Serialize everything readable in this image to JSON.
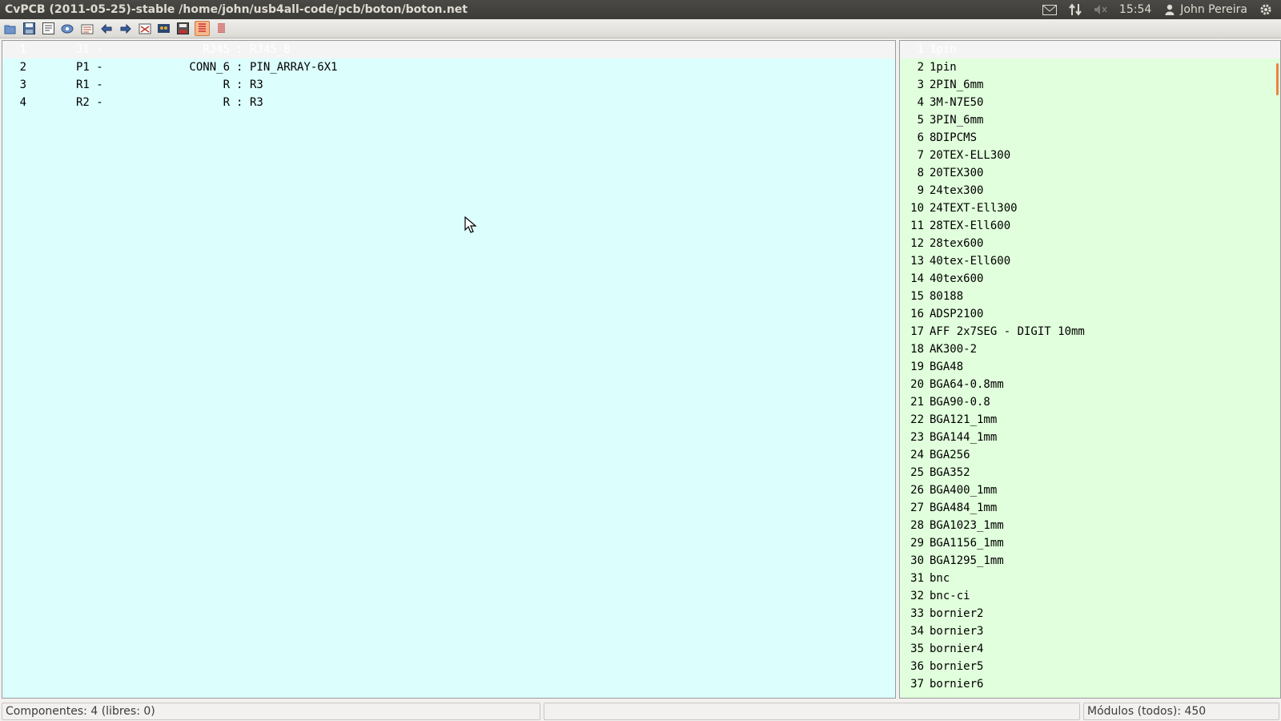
{
  "window": {
    "title": "CvPCB (2011-05-25)-stable /home/john/usb4all-code/pcb/boton/boton.net"
  },
  "panel": {
    "time": "15:54",
    "user": "John Pereira",
    "icons": [
      "mail-icon",
      "network-icon",
      "volume-muted-icon",
      "user-icon",
      "gear-icon"
    ]
  },
  "toolbar": {
    "buttons": [
      "open-icon",
      "save-icon",
      "config-icon",
      "library-icon",
      "auto-associate-icon",
      "previous-icon",
      "next-icon",
      "delete-associations-icon",
      "view-footprint-icon",
      "save-equ-icon",
      "filter-by-component-icon",
      "full-list-icon"
    ]
  },
  "components": [
    {
      "num": "1",
      "ref": "J1 -",
      "value": "RJ45",
      "footprint": "RJ45_8"
    },
    {
      "num": "2",
      "ref": "P1 -",
      "value": "CONN_6",
      "footprint": "PIN_ARRAY-6X1"
    },
    {
      "num": "3",
      "ref": "R1 -",
      "value": "R",
      "footprint": "R3"
    },
    {
      "num": "4",
      "ref": "R2 -",
      "value": "R",
      "footprint": "R3"
    }
  ],
  "modules": [
    "1pin",
    "1pin",
    "2PIN_6mm",
    "3M-N7E50",
    "3PIN_6mm",
    "8DIPCMS",
    "20TEX-ELL300",
    "20TEX300",
    "24tex300",
    "24TEXT-Ell300",
    "28TEX-Ell600",
    "28tex600",
    "40tex-Ell600",
    "40tex600",
    "80188",
    "ADSP2100",
    "AFF 2x7SEG - DIGIT 10mm",
    "AK300-2",
    "BGA48",
    "BGA64-0.8mm",
    "BGA90-0.8",
    "BGA121_1mm",
    "BGA144_1mm",
    "BGA256",
    "BGA352",
    "BGA400_1mm",
    "BGA484_1mm",
    "BGA1023_1mm",
    "BGA1156_1mm",
    "BGA1295_1mm",
    "bnc",
    "bnc-ci",
    "bornier2",
    "bornier3",
    "bornier4",
    "bornier5",
    "bornier6"
  ],
  "status": {
    "left": "Componentes: 4 (libres: 0)",
    "middle": "",
    "right": "Módulos (todos): 450"
  },
  "colors": {
    "left_bg": "#dcfffe",
    "right_bg": "#e1ffdc",
    "selected_bg": "#f4f4f4"
  }
}
